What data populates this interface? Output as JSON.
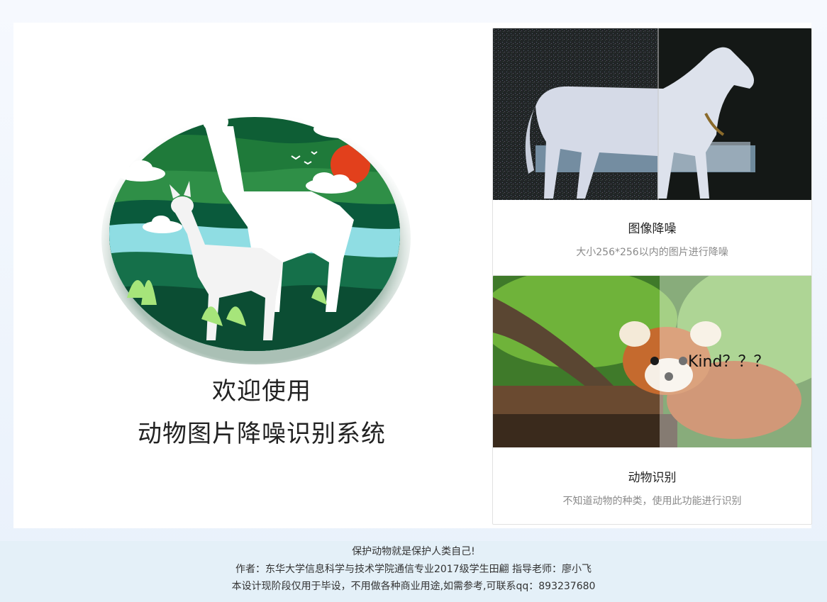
{
  "hero": {
    "welcome_line1": "欢迎使用",
    "welcome_line2": "动物图片降噪识别系统"
  },
  "cards": [
    {
      "title": "图像降噪",
      "description": "大小256*256以内的图片进行降噪",
      "image": "horse-denoise-comparison"
    },
    {
      "title": "动物识别",
      "description": "不知道动物的种类，使用此功能进行识别",
      "image": "red-panda-recognition",
      "overlay_text": "Kind？？？"
    }
  ],
  "footer": {
    "line1": "保护动物就是保护人类自己!",
    "line2": "作者：东华大学信息科学与技术学院通信专业2017级学生田翩 指导老师：廖小飞",
    "line3": "本设计现阶段仅用于毕设，不用做各种商业用途,如需参考,可联系qq：893237680"
  },
  "colors": {
    "accent_green": "#1f7a3a",
    "sun_red": "#e2401c",
    "footer_bg": "#e4f0f8"
  }
}
